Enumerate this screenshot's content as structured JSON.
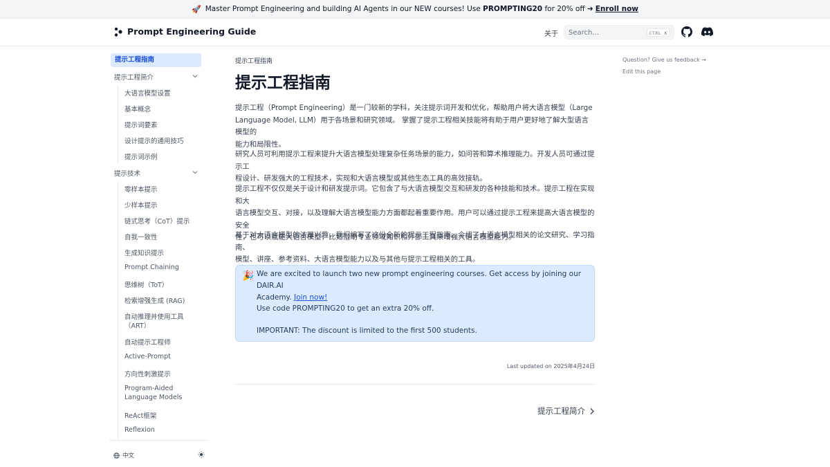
{
  "banner": {
    "text": "Master Prompt Engineering and building AI Agents in our NEW courses! Use",
    "code": "PROMPTING20",
    "suffix": "for 20% off ➜",
    "link": "Enroll now"
  },
  "navbar": {
    "title": "Prompt Engineering Guide",
    "about": "关于",
    "search_placeholder": "Search...",
    "shortcut": "CTRL K"
  },
  "sidebar": {
    "active": "提示工程指南",
    "sections": [
      {
        "label": "提示工程简介",
        "items": [
          "大语言模型设置",
          "基本概念",
          "提示词要素",
          "设计提示的通用技巧",
          "提示词示例"
        ]
      },
      {
        "label": "提示技术",
        "items": [
          "零样本提示",
          "少样本提示",
          "链式思考（CoT）提示",
          "自我一致性",
          "生成知识提示",
          "Prompt Chaining",
          "思维树（ToT）",
          "检索增强生成 (RAG)",
          "自动推理并使用工具",
          "（ART）",
          "自动提示工程师",
          "Active-Prompt",
          "方向性刺激提示",
          "Program-Aided",
          "Language Models",
          "ReAct框架",
          "Reflexion"
        ]
      }
    ],
    "language": "中文"
  },
  "main": {
    "breadcrumb": "提示工程指南",
    "title": "提示工程指南",
    "paragraphs": [
      [
        "提示工程（Prompt Engineering）是一门较新的学科，关注提示词开发和优化，帮助用户将大语言模型（Large",
        "Language Model, LLM）用于各场景和研究领域。 掌握了提示工程相关技能将有助于用户更好地了解大型语言模型的",
        "能力和局限性。"
      ],
      [
        "研究人员可利用提示工程来提升大语言模型处理复杂任务场景的能力，如问答和算术推理能力。开发人员可通过提示工",
        "程设计、研发强大的工程技术，实现和大语言模型或其他生态工具的高效接轨。"
      ],
      [
        "提示工程不仅仅是关于设计和研发提示词。它包含了与大语言模型交互和研发的各种技能和技术。提示工程在实现和大",
        "语言模型交互、对接，以及理解大语言模型能力方面都起着重要作用。用户可以通过提示工程来提高大语言模型的安全",
        "性，也可以赋能大语言模型，比如借助专业领域知识和外部工具来增强大语言模型能力。"
      ],
      [
        "基于对大语言模型的浓厚兴趣，我们编写了这份全新的提示工程指南，介绍了大语言模型相关的论文研究、学习指南、",
        "模型、讲座、参考资料、大语言模型能力以及与其他与提示工程相关的工具。"
      ]
    ],
    "callout": {
      "line1": "We are excited to launch two new prompt engineering courses. Get access by joining our DAIR.AI",
      "line2": "Academy.",
      "link": "Join now!",
      "line3": "Use code PROMPTING20 to get an extra 20% off.",
      "line4": "IMPORTANT: The discount is limited to the first 500 students."
    },
    "last_updated": "Last updated on 2025年4月24日",
    "next_page": "提示工程简介"
  },
  "toc": {
    "feedback": "Question? Give us feedback →",
    "edit": "Edit this page"
  },
  "colors": {
    "active_bg": "#dbeafe",
    "active_text": "#1d4ed8",
    "callout_bg": "#dbeafe",
    "link": "#1d4ed8"
  }
}
